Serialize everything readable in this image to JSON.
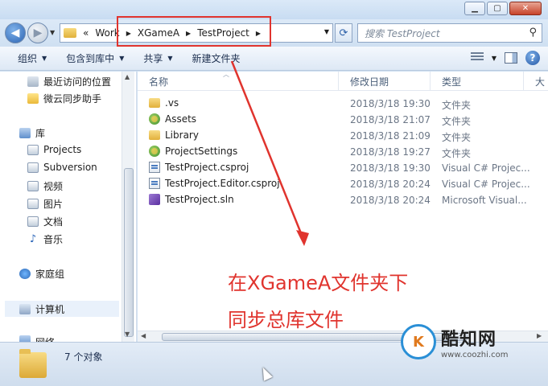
{
  "address": {
    "crumbs": [
      "Work",
      "XGameA",
      "TestProject"
    ],
    "overflow": "«"
  },
  "search": {
    "placeholder": "搜索 TestProject"
  },
  "toolbar": {
    "organize": "组织",
    "include_in_library": "包含到库中",
    "share": "共享",
    "new_folder": "新建文件夹"
  },
  "navpane": {
    "recent": "最近访问的位置",
    "cloud_sync": "微云同步助手",
    "library": "库",
    "projects": "Projects",
    "subversion": "Subversion",
    "video": "视频",
    "pictures": "图片",
    "documents": "文档",
    "music": "音乐",
    "homegroup": "家庭组",
    "computer": "计算机",
    "network": "网络"
  },
  "columns": {
    "name": "名称",
    "date": "修改日期",
    "type": "类型",
    "size": "大"
  },
  "files": [
    {
      "name": ".vs",
      "date": "2018/3/18 19:30",
      "type": "文件夹",
      "icon": "folder-icon"
    },
    {
      "name": "Assets",
      "date": "2018/3/18 21:07",
      "type": "文件夹",
      "icon": "unity-folder-icon"
    },
    {
      "name": "Library",
      "date": "2018/3/18 21:09",
      "type": "文件夹",
      "icon": "folder-icon"
    },
    {
      "name": "ProjectSettings",
      "date": "2018/3/18 19:27",
      "type": "文件夹",
      "icon": "unity-folder-icon"
    },
    {
      "name": "TestProject.csproj",
      "date": "2018/3/18 19:30",
      "type": "Visual C# Projec...",
      "icon": "csproj-icon"
    },
    {
      "name": "TestProject.Editor.csproj",
      "date": "2018/3/18 20:24",
      "type": "Visual C# Projec...",
      "icon": "csproj-icon"
    },
    {
      "name": "TestProject.sln",
      "date": "2018/3/18 20:24",
      "type": "Microsoft Visual...",
      "icon": "sln-icon"
    }
  ],
  "status": {
    "count": "7 个对象"
  },
  "annotation": {
    "line1": "在XGameA文件夹下",
    "line2": "同步总库文件",
    "color": "#e0342e"
  },
  "watermark": {
    "logo": "K",
    "name": "酷知网",
    "url": "www.coozhi.com"
  }
}
